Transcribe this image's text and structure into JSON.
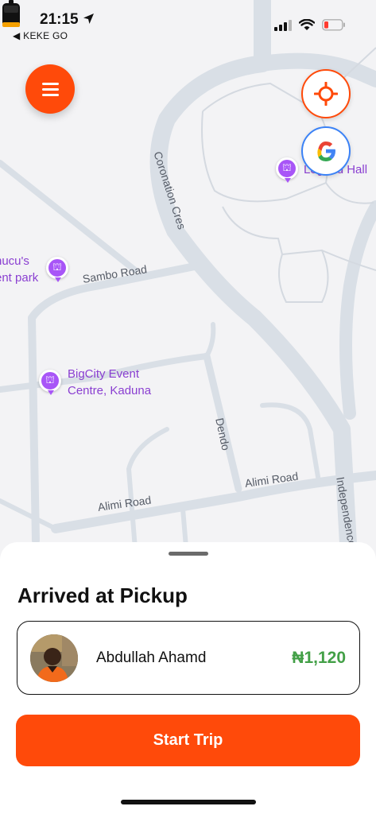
{
  "status_bar": {
    "time": "21:15",
    "back_app": "◀ KEKE GO"
  },
  "map": {
    "roads": [
      {
        "name": "Coronation Cres"
      },
      {
        "name": "Sambo Road"
      },
      {
        "name": "Dendo"
      },
      {
        "name": "Alimi Road"
      },
      {
        "name": "Alimi Road"
      },
      {
        "name": "Independence"
      }
    ],
    "places": [
      {
        "name_line1": "hucu's",
        "name_line2": "ent park"
      },
      {
        "name_line1": "BigCity Event",
        "name_line2": "Centre, Kaduna"
      },
      {
        "name_line1": "Legend Hall",
        "name_line2": ""
      }
    ]
  },
  "controls": {
    "menu": "menu",
    "locate": "locate",
    "google": "G"
  },
  "trip_sheet": {
    "title": "Arrived at Pickup",
    "driver_name": "Abdullah Ahamd",
    "fare": "₦1,120",
    "start_button": "Start Trip"
  },
  "colors": {
    "accent": "#ff4a0a",
    "fare_green": "#43a047",
    "poi_purple": "#a855f7",
    "google_blue": "#3b82f6"
  }
}
